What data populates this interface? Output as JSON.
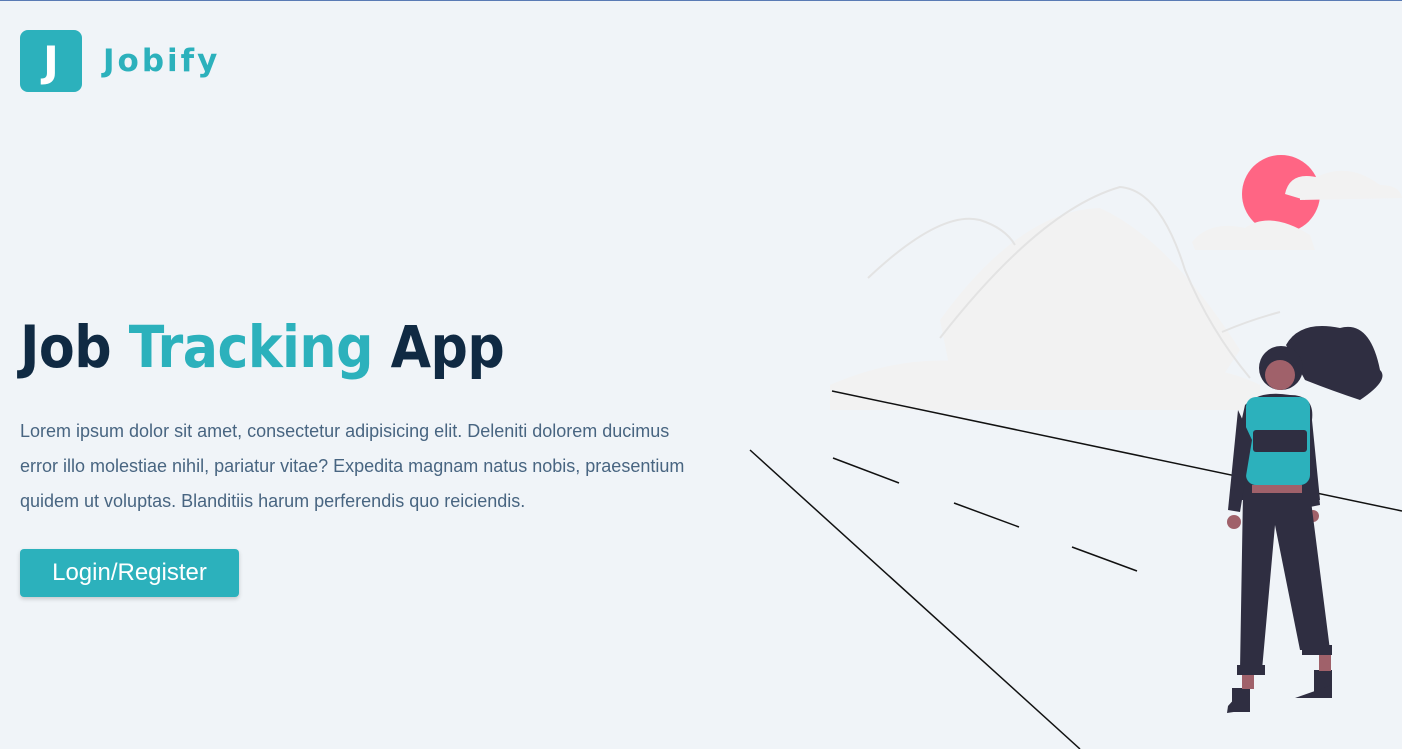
{
  "nav": {
    "logo_letter": "J",
    "brand_name": "Jobify"
  },
  "hero": {
    "title_part1": "Job ",
    "title_accent": "Tracking",
    "title_part2": " App",
    "description": "Lorem ipsum dolor sit amet, consectetur adipisicing elit. Deleniti dolorem ducimus error illo molestiae nihil, pariatur vitae? Expedita magnam natus nobis, praesentium quidem ut voluptas. Blanditiis harum perferendis quo reiciendis.",
    "cta_label": "Login/Register"
  },
  "colors": {
    "primary": "#2cb1bc",
    "heading": "#102a43",
    "body_text": "#486581",
    "background": "#f0f4f8",
    "sun": "#ff6584",
    "figure_dark": "#2f2e41"
  },
  "icons": {
    "illustration": "traveler-with-backpack-on-road-illustration"
  }
}
